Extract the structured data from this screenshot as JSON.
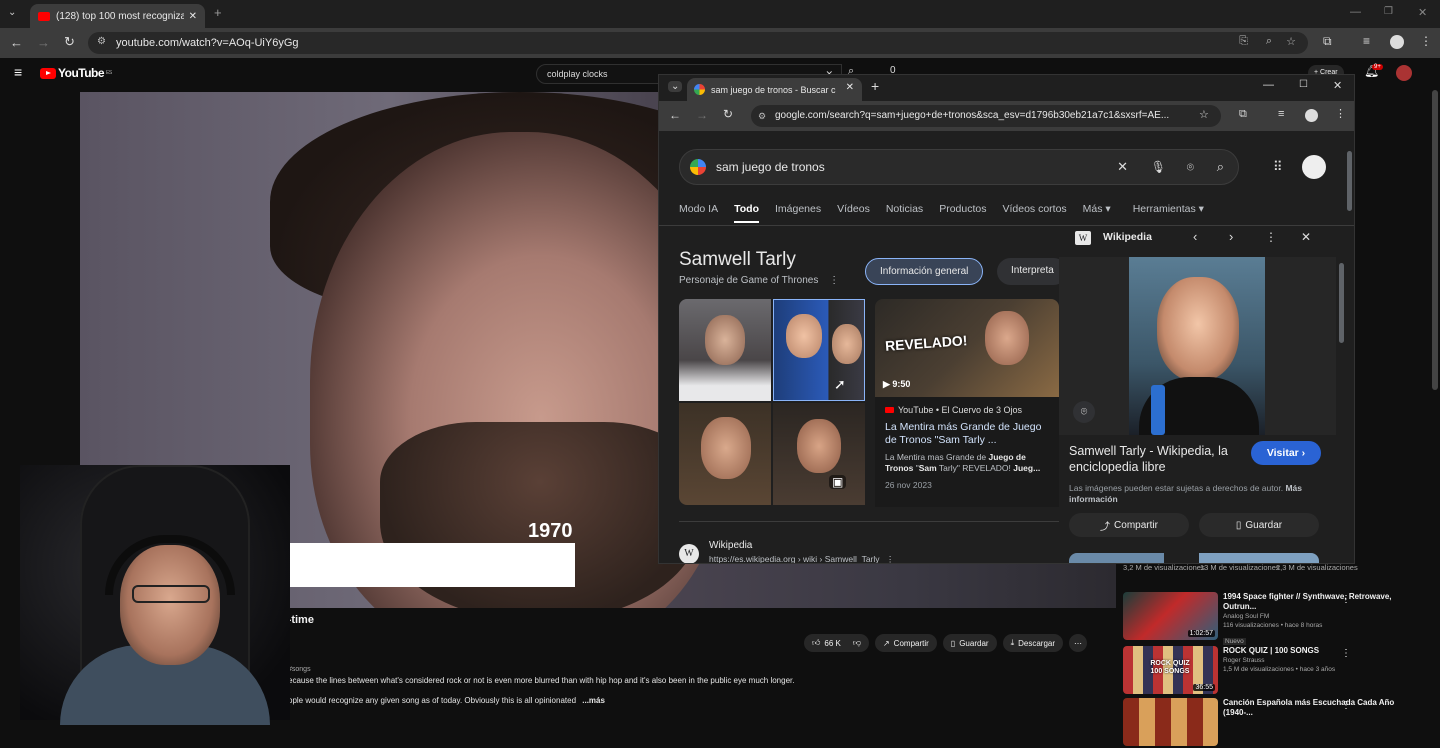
{
  "outer_browser": {
    "tab_title": "(128) top 100 most recognizabl",
    "url": "youtube.com/watch?v=AOq-UiY6yGg"
  },
  "youtube": {
    "logo": "YouTube",
    "logo_country": "ES",
    "search_value": "coldplay clocks",
    "notif_count": "9+",
    "create_label": "Crear",
    "mic_label": "0",
    "video_overlay_year": "1970",
    "video_title_fragment": "of all-time",
    "songs_tag": "#songs",
    "description_line1": "ecause the lines between what's considered rock or not is even more blurred than with hip hop and it's also been in the public eye much longer.",
    "description_line2": "ople would recognize any given song as of today. Obviously this is all opinionated",
    "more_label": "...más",
    "actions": {
      "likes": "66 K",
      "share": "Compartir",
      "save": "Guardar",
      "download": "Descargar"
    },
    "sidebar_views": [
      "3,2 M de visualizaciones",
      "13 M de visualizaciones",
      "2,3 M de visualizaciones"
    ],
    "sidebar_items": [
      {
        "title": "1994 Space fighter // Synthwave, Retrowave, Outrun...",
        "channel": "Analog Soul FM",
        "meta": "116 visualizaciones • hace 8 horas",
        "badge": "Nuevo",
        "duration": "1:02:57"
      },
      {
        "title": "ROCK QUIZ | 100 SONGS",
        "channel": "Roger Strauss",
        "meta": "1,5 M de visualizaciones • hace 3 años",
        "thumb_text": "ROCK QUIZ 100 SONGS",
        "duration": "36:55"
      },
      {
        "title": "Canción Española más Escuchada Cada Año (1940-...",
        "channel": "",
        "meta": ""
      }
    ]
  },
  "inner_browser": {
    "tab_title": "sam juego de tronos - Buscar c",
    "url": "google.com/search?q=sam+juego+de+tronos&sca_esv=d1796b30eb21a7c1&sxsrf=AE..."
  },
  "google": {
    "query": "sam juego de tronos",
    "tabs": [
      "Modo IA",
      "Todo",
      "Imágenes",
      "Vídeos",
      "Noticias",
      "Productos",
      "Vídeos cortos",
      "Más",
      "Herramientas"
    ],
    "active_tab": "Todo",
    "knowledge_panel": {
      "title": "Samwell Tarly",
      "subtitle": "Personaje de Game of Thrones",
      "chip_active": "Información general",
      "chip_next": "Interpreta"
    },
    "video_card": {
      "thumb_text": "REVELADO!",
      "duration": "9:50",
      "source": "YouTube • El Cuervo de 3 Ojos",
      "title": "La Mentira más Grande de Juego de Tronos \"Sam Tarly ...",
      "snippet_plain1": "La Mentira mas Grande de ",
      "snippet_bold1": "Juego de Tronos",
      "snippet_plain2": " \"",
      "snippet_bold2": "Sam",
      "snippet_plain3": " Tarly\" REVELADO! ",
      "snippet_bold3": "Jueg...",
      "date": "26 nov 2023"
    },
    "wiki_panel": {
      "source": "Wikipedia",
      "title": "Samwell Tarly - Wikipedia, la enciclopedia libre",
      "visit": "Visitar",
      "notice": "Las imágenes pueden estar sujetas a derechos de autor.",
      "notice_more": "Más información",
      "share": "Compartir",
      "save": "Guardar"
    },
    "result": {
      "site": "Wikipedia",
      "url": "https://es.wikipedia.org › wiki › Samwell_Tarly"
    }
  },
  "colors": {
    "youtube_red": "#ff0000",
    "google_blue_button": "#2a63d4",
    "chip_active_bg": "#394457"
  }
}
